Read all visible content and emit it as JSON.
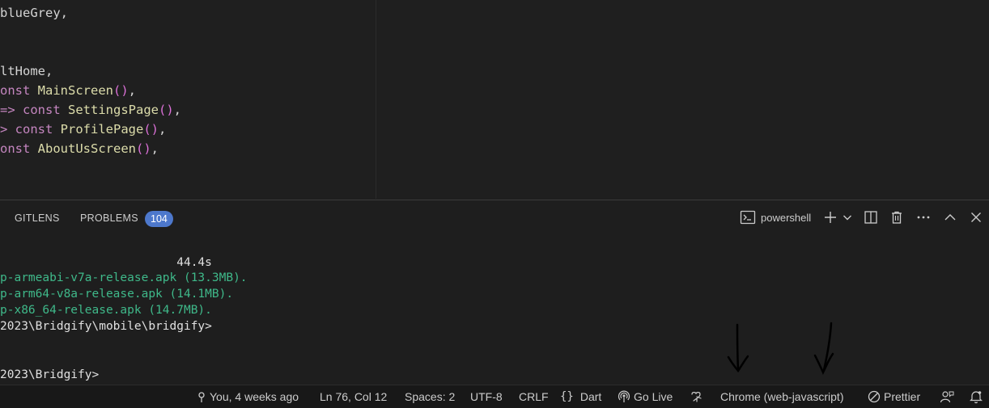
{
  "editor": {
    "lines": [
      {
        "parts": [
          {
            "t": "blueGrey,",
            "c": "plain"
          }
        ]
      },
      {
        "parts": [
          {
            "t": "ltHome,",
            "c": "plain"
          }
        ]
      },
      {
        "parts": [
          {
            "t": "onst ",
            "c": "kw"
          },
          {
            "t": "MainScreen",
            "c": "fn"
          },
          {
            "t": "()",
            "c": "pn"
          },
          {
            "t": ",",
            "c": "plain"
          }
        ]
      },
      {
        "parts": [
          {
            "t": "=> ",
            "c": "kw"
          },
          {
            "t": "const ",
            "c": "kw"
          },
          {
            "t": "SettingsPage",
            "c": "fn"
          },
          {
            "t": "()",
            "c": "pn"
          },
          {
            "t": ",",
            "c": "plain"
          }
        ]
      },
      {
        "parts": [
          {
            "t": "> ",
            "c": "kw"
          },
          {
            "t": "const ",
            "c": "kw"
          },
          {
            "t": "ProfilePage",
            "c": "fn"
          },
          {
            "t": "()",
            "c": "pn"
          },
          {
            "t": ",",
            "c": "plain"
          }
        ]
      },
      {
        "parts": [
          {
            "t": "onst ",
            "c": "kw"
          },
          {
            "t": "AboutUsScreen",
            "c": "fn"
          },
          {
            "t": "()",
            "c": "pn"
          },
          {
            "t": ",",
            "c": "plain"
          }
        ]
      }
    ]
  },
  "panel": {
    "tabs": [
      {
        "label": "GITLENS"
      },
      {
        "label": "PROBLEMS",
        "badge": "104"
      }
    ],
    "terminal_name": "powershell"
  },
  "terminal": {
    "lines": [
      {
        "text": "                         44.4s",
        "color": "white"
      },
      {
        "text": "p-armeabi-v7a-release.apk (13.3MB).",
        "color": "green"
      },
      {
        "text": "p-arm64-v8a-release.apk (14.1MB).",
        "color": "green"
      },
      {
        "text": "p-x86_64-release.apk (14.7MB).",
        "color": "green"
      },
      {
        "text": "2023\\Bridgify\\mobile\\bridgify>",
        "color": "white"
      },
      {
        "text": "2023\\Bridgify>",
        "color": "white"
      }
    ]
  },
  "statusbar": {
    "blame": "You, 4 weeks ago",
    "position": "Ln 76, Col 12",
    "spaces": "Spaces: 2",
    "encoding": "UTF-8",
    "eol": "CRLF",
    "language": "Dart",
    "golive": "Go Live",
    "device": "Chrome (web-javascript)",
    "prettier": "Prettier"
  },
  "colors": {
    "accent_badge": "#4d78cc",
    "terminal_green": "#3fb98a",
    "keyword": "#c586c0",
    "function": "#dcdcaa"
  }
}
